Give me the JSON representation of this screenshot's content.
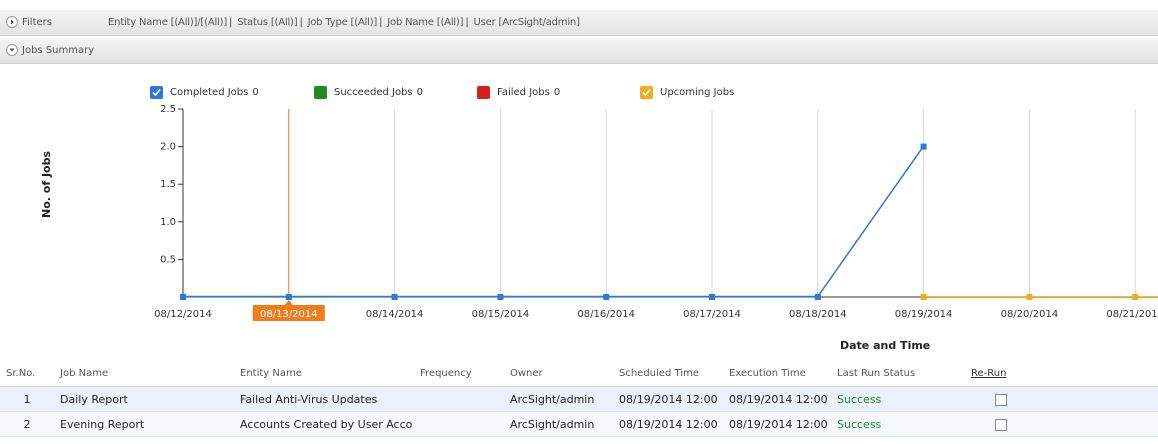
{
  "filters": {
    "label": "Filters",
    "crumbs": [
      "Entity Name [(All)]/[(All)]",
      "Status [(All)]",
      "Job Type [(All)]",
      "Job Name [(All)]",
      "User [ArcSight/admin]"
    ]
  },
  "summary": {
    "label": "Jobs Summary"
  },
  "legend": [
    {
      "label": "Completed Jobs",
      "count": "0",
      "color": "#2a7ad9",
      "checked": true
    },
    {
      "label": "Succeeded Jobs",
      "count": "0",
      "color": "#1e8c1e",
      "checked": false
    },
    {
      "label": "Failed Jobs",
      "count": "0",
      "color": "#d4201f",
      "checked": false
    },
    {
      "label": "Upcoming Jobs",
      "count": "",
      "color": "#f0ad1c",
      "checked": true
    }
  ],
  "chart_data": {
    "type": "line",
    "title": "",
    "xlabel": "Date and Time",
    "ylabel": "No. of Jobs",
    "categories": [
      "08/12/2014",
      "08/13/2014",
      "08/14/2014",
      "08/15/2014",
      "08/16/2014",
      "08/17/2014",
      "08/18/2014",
      "08/19/2014",
      "08/20/2014",
      "08/21/2014"
    ],
    "ylim": [
      0,
      2.5
    ],
    "yticks": [
      "2.5",
      "2.0",
      "1.5",
      "1.0",
      "0.5"
    ],
    "highlighted_category": "08/13/2014",
    "series": [
      {
        "name": "Completed Jobs",
        "color": "#2a7ad9",
        "values": [
          0,
          0,
          0,
          0,
          0,
          0,
          0,
          2,
          null,
          null
        ]
      },
      {
        "name": "Upcoming Jobs",
        "color": "#f0ad1c",
        "values": [
          null,
          null,
          null,
          null,
          null,
          null,
          null,
          0,
          0,
          0
        ]
      }
    ],
    "grid": true
  },
  "table": {
    "headers": [
      "Sr.No.",
      "Job Name",
      "Entity Name",
      "Frequency",
      "Owner",
      "Scheduled Time",
      "Execution Time",
      "Last Run Status",
      "Re-Run"
    ],
    "rows": [
      [
        "1",
        "Daily Report",
        "Failed Anti-Virus Updates",
        "",
        "ArcSight/admin",
        "08/19/2014 12:00",
        "08/19/2014 12:00",
        "Success"
      ],
      [
        "2",
        "Evening Report",
        "Accounts Created by User Acco",
        "",
        "ArcSight/admin",
        "08/19/2014 12:00",
        "08/19/2014 12:00",
        "Success"
      ]
    ]
  }
}
